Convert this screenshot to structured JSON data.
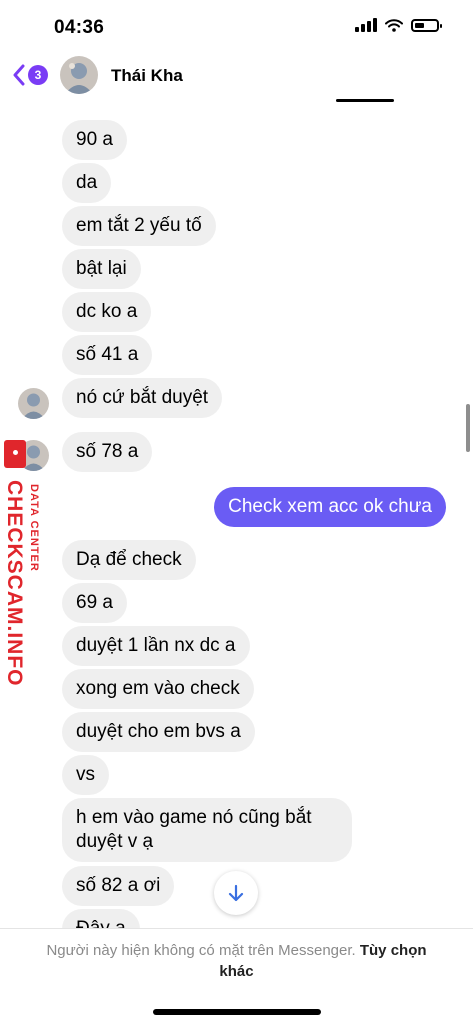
{
  "status_bar": {
    "time": "04:36"
  },
  "header": {
    "back_count": "3",
    "contact_name": "Thái Kha"
  },
  "messages": [
    {
      "text": "90 a"
    },
    {
      "text": "da"
    },
    {
      "text": "em tắt 2 yếu tố"
    },
    {
      "text": "bật lại"
    },
    {
      "text": "dc ko a"
    },
    {
      "text": "số 41 a"
    },
    {
      "text": "nó cứ bắt duyệt"
    },
    {
      "text": "số 78 a"
    },
    {
      "text": "Check xem acc ok chưa"
    },
    {
      "text": "Dạ để check"
    },
    {
      "text": "69 a"
    },
    {
      "text": "duyệt 1 lần nx dc a"
    },
    {
      "text": "xong em vào check"
    },
    {
      "text": "duyệt cho em bvs a"
    },
    {
      "text": "vs"
    },
    {
      "text": "h em vào game nó cũng bắt duyệt v ạ"
    },
    {
      "text": "số 82 a ơi"
    },
    {
      "text": "Đây ạ"
    }
  ],
  "watermark": {
    "brand": "CHECKSCAM.INFO",
    "tagline": "DATA CENTER"
  },
  "footer": {
    "notice": "Người này hiện không có mặt trên Messenger.",
    "link": "Tùy chọn khác"
  },
  "colors": {
    "accent": "#7a3cf5",
    "outgoing_bubble": "#6a5cf4",
    "incoming_bubble": "#efefef",
    "watermark": "#e0262c"
  },
  "icons": [
    "chevron-left-icon",
    "cellular-signal-icon",
    "wifi-icon",
    "battery-icon",
    "arrow-down-icon"
  ]
}
